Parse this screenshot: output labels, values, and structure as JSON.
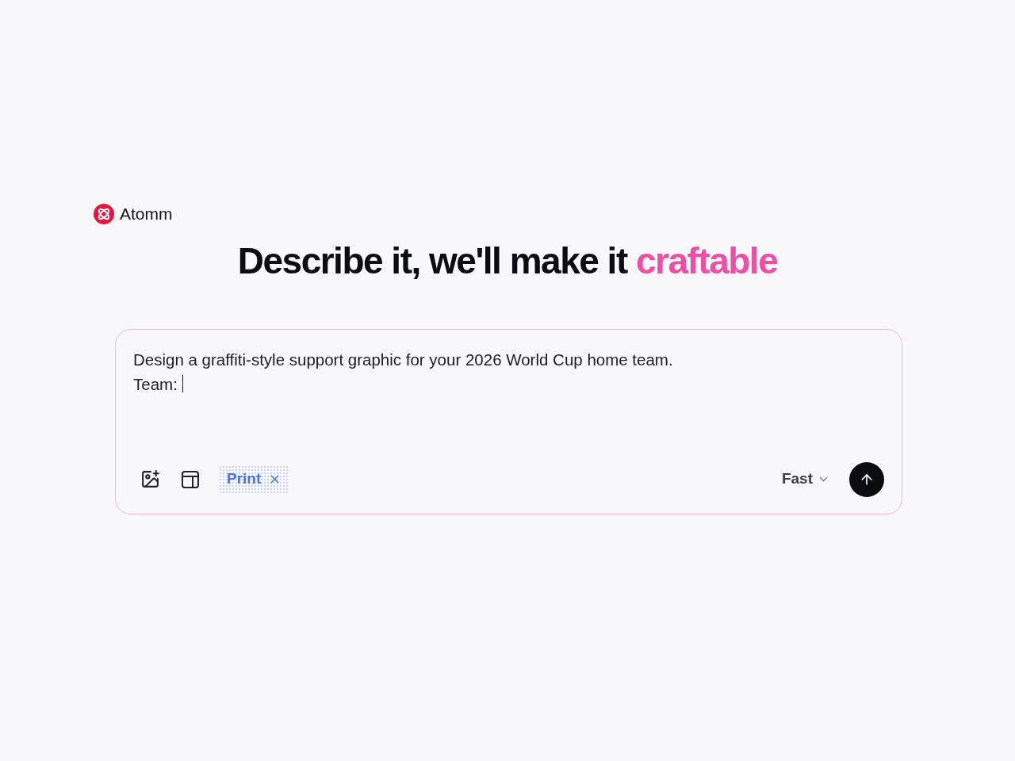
{
  "brand": {
    "name": "Atomm"
  },
  "headline": {
    "text": "Describe it, we'll make it",
    "accent": "craftable"
  },
  "prompt": {
    "value": "Design a graffiti-style support graphic for your 2026 World Cup home team.\nTeam: ",
    "focused": true
  },
  "chips": [
    {
      "label": "Print"
    }
  ],
  "model_select": {
    "label": "Fast"
  }
}
